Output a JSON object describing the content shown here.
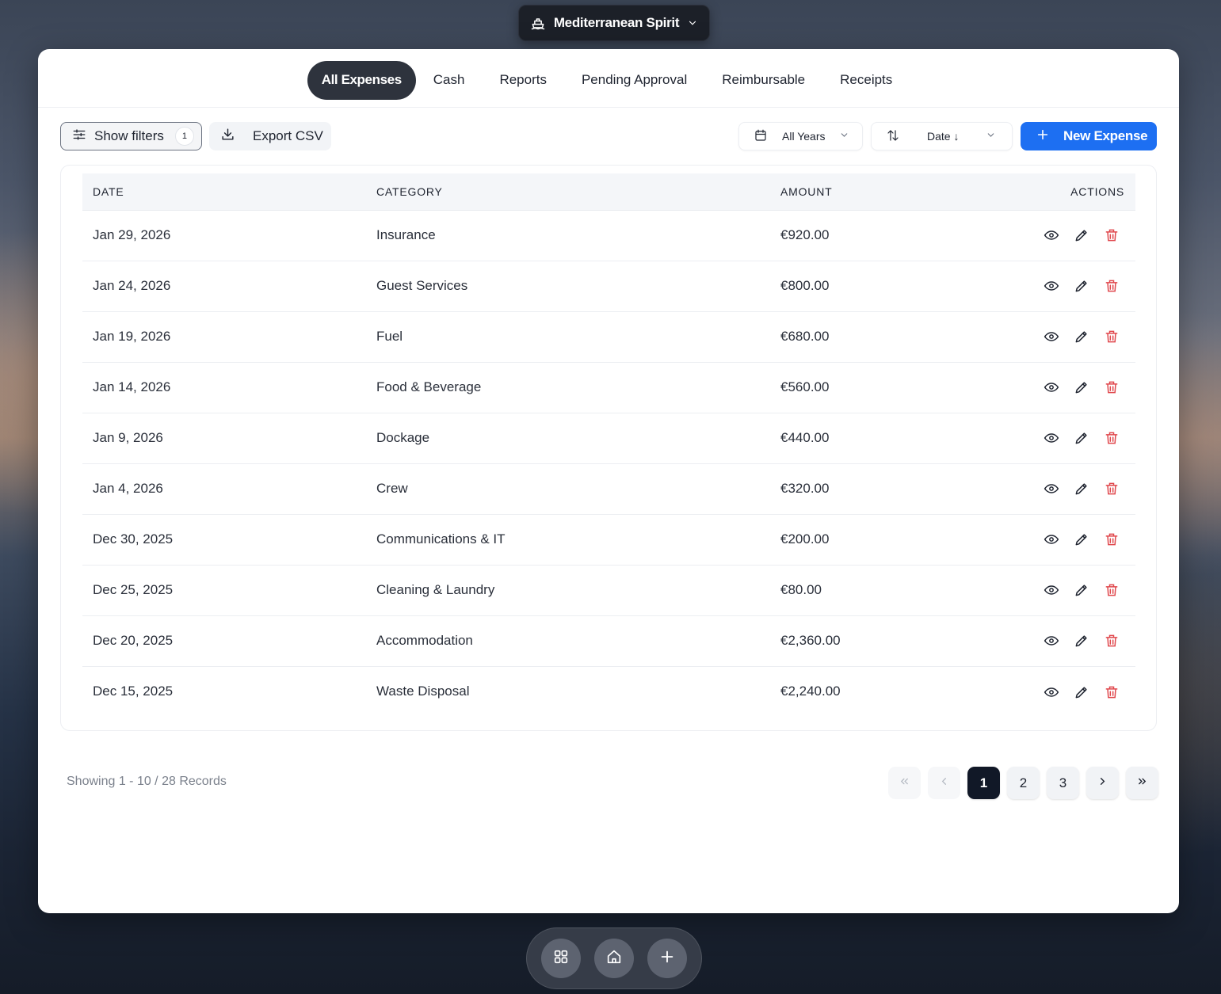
{
  "vessel_picker": {
    "label": "Mediterranean Spirit"
  },
  "tabs": [
    {
      "label": "All Expenses",
      "active": true
    },
    {
      "label": "Cash"
    },
    {
      "label": "Reports"
    },
    {
      "label": "Pending Approval"
    },
    {
      "label": "Reimbursable"
    },
    {
      "label": "Receipts"
    }
  ],
  "toolbar": {
    "filters_label": "Show filters",
    "filters_count": "1",
    "export_label": "Export CSV",
    "year_select": "All Years",
    "sort_select": "Date ↓",
    "new_label": "New Expense",
    "accent_color": "#1d6ff2"
  },
  "table": {
    "headers": {
      "date": "DATE",
      "category": "CATEGORY",
      "amount": "AMOUNT",
      "actions": "ACTIONS"
    },
    "rows": [
      {
        "date": "Jan 29, 2026",
        "category": "Insurance",
        "amount": "€920.00"
      },
      {
        "date": "Jan 24, 2026",
        "category": "Guest Services",
        "amount": "€800.00"
      },
      {
        "date": "Jan 19, 2026",
        "category": "Fuel",
        "amount": "€680.00"
      },
      {
        "date": "Jan 14, 2026",
        "category": "Food & Beverage",
        "amount": "€560.00"
      },
      {
        "date": "Jan 9, 2026",
        "category": "Dockage",
        "amount": "€440.00"
      },
      {
        "date": "Jan 4, 2026",
        "category": "Crew",
        "amount": "€320.00"
      },
      {
        "date": "Dec 30, 2025",
        "category": "Communications & IT",
        "amount": "€200.00"
      },
      {
        "date": "Dec 25, 2025",
        "category": "Cleaning & Laundry",
        "amount": "€80.00"
      },
      {
        "date": "Dec 20, 2025",
        "category": "Accommodation",
        "amount": "€2,360.00"
      },
      {
        "date": "Dec 15, 2025",
        "category": "Waste Disposal",
        "amount": "€2,240.00"
      }
    ]
  },
  "footer": {
    "records_text": "Showing 1 - 10 / 28 Records",
    "pages": [
      "1",
      "2",
      "3"
    ],
    "current_page": "1"
  },
  "icons": {
    "row_actions": [
      "eye-icon",
      "pencil-icon",
      "trash-icon"
    ],
    "delete_color": "#e0474c",
    "dock": [
      "grid-icon",
      "home-icon",
      "plus-icon"
    ]
  }
}
